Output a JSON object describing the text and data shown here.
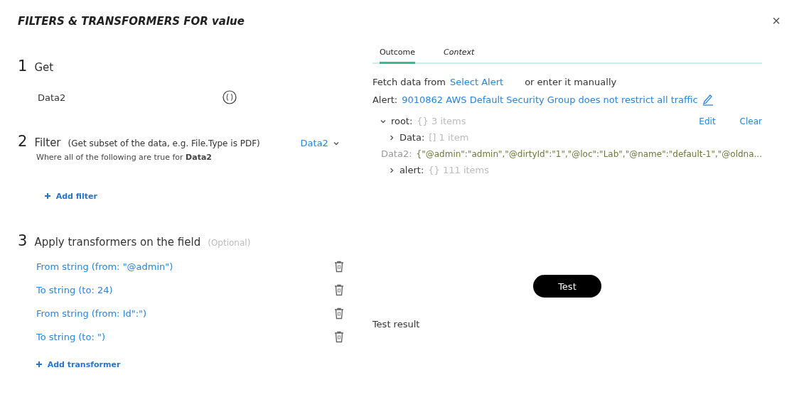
{
  "dialog": {
    "title": "FILTERS & TRANSFORMERS FOR value",
    "close": "×"
  },
  "steps": [
    {
      "number": "1",
      "kind": "get",
      "label": "Get",
      "value": "Data2"
    },
    {
      "number": "2",
      "kind": "filter",
      "label": "Filter",
      "hint": "(Get subset of the data, e.g. File.Type is PDF)",
      "selector": "Data2",
      "condition": "Where all of the following are true for",
      "condition_target": "Data2",
      "add": "Add filter"
    },
    {
      "number": "3",
      "kind": "transform",
      "label": "Apply transformers on the field",
      "hint": "(Optional)",
      "items": [
        "From string (from: \"@admin\")",
        "To string (to: 24)",
        "From string (from: Id\":\")",
        "To string (to: \")"
      ],
      "add": "Add transformer"
    }
  ],
  "tabs": [
    {
      "label": "Outcome",
      "selected": true
    },
    {
      "label": "Context",
      "selected": false
    }
  ],
  "fetch": {
    "text": "Fetch data from",
    "link": "Select Alert",
    "manual": "or enter it manually"
  },
  "alert": {
    "label": "Alert:",
    "link": "9010862 AWS Default Security Group does not restrict all traffic"
  },
  "tree_actions": [
    "Edit",
    "Clear"
  ],
  "tree": {
    "key": "root:",
    "summary": "{} 3 items",
    "expanded": true,
    "children": [
      {
        "kind": "node",
        "key": "Data:",
        "summary": "[] 1 item",
        "expanded": false
      },
      {
        "kind": "value",
        "key": "Data2:",
        "value": "{\"@admin\":\"admin\",\"@dirtyId\":\"1\",\"@loc\":\"Lab\",\"@name\":\"default-1\",\"@oldna..."
      },
      {
        "kind": "node",
        "key": "alert:",
        "summary": "{} 111 items",
        "expanded": false
      }
    ]
  },
  "test_button": "Test",
  "test_result": "Test result"
}
